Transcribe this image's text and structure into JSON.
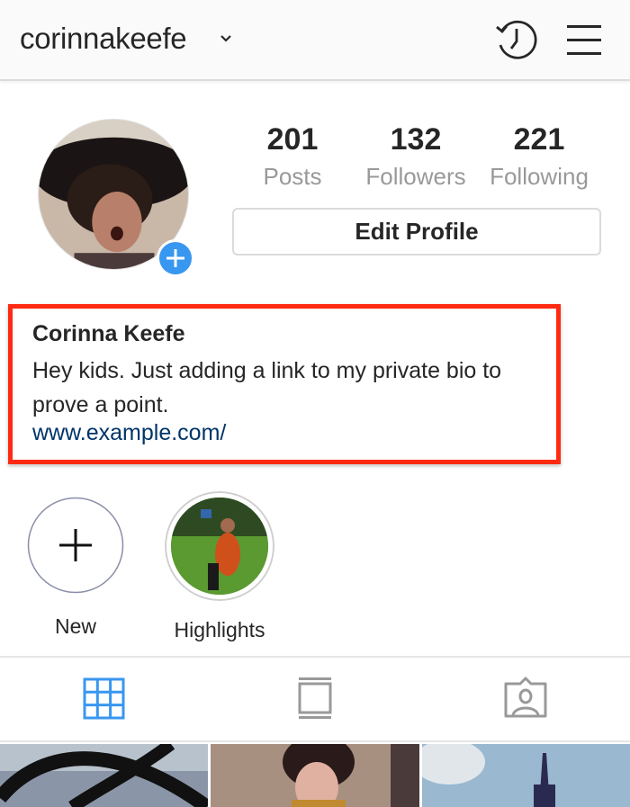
{
  "header": {
    "username": "corinnakeefe",
    "icons": [
      "chevron-down-icon",
      "history-icon",
      "menu-icon"
    ]
  },
  "profile": {
    "stats": [
      {
        "value": "201",
        "label": "Posts"
      },
      {
        "value": "132",
        "label": "Followers"
      },
      {
        "value": "221",
        "label": "Following"
      }
    ],
    "edit_button_label": "Edit Profile",
    "add_story_icon": "plus-icon"
  },
  "bio": {
    "name": "Corinna Keefe",
    "text": "Hey kids. Just adding a link to my private bio to prove a point.",
    "link": "www.example.com/",
    "highlight_box_color": "#ff2a12",
    "link_color": "#003569"
  },
  "highlights": [
    {
      "label": "New",
      "icon": "plus-icon"
    },
    {
      "label": "Highlights",
      "icon": "highlight-photo"
    }
  ],
  "tabs": [
    {
      "name": "grid",
      "icon": "grid-icon",
      "active": true
    },
    {
      "name": "feed",
      "icon": "feed-icon",
      "active": false
    },
    {
      "name": "tagged",
      "icon": "tagged-icon",
      "active": false
    }
  ],
  "colors": {
    "accent": "#3897f0",
    "inactive_icon": "#999999",
    "text": "#262626"
  }
}
